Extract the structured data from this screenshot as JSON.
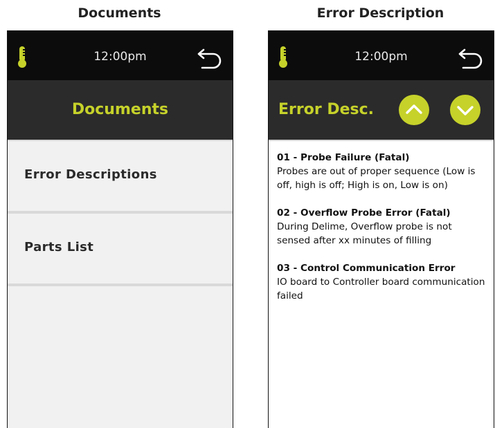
{
  "captions": {
    "left": "Documents",
    "right": "Error Description"
  },
  "status_bar": {
    "time": "12:00pm"
  },
  "documents_screen": {
    "title": "Documents",
    "items": [
      {
        "label": "Error Descriptions"
      },
      {
        "label": "Parts List"
      }
    ]
  },
  "error_screen": {
    "title": "Error Desc.",
    "errors": [
      {
        "title": "01 - Probe Failure (Fatal)",
        "desc": "Probes are out of proper sequence (Low is off, high is off; High is on, Low is on)"
      },
      {
        "title": "02 - Overflow Probe Error (Fatal)",
        "desc": "During Delime, Overflow probe is not sensed after xx minutes of filling"
      },
      {
        "title": "03 - Control Communication Error",
        "desc": "IO board to Controller board communication failed"
      }
    ]
  },
  "colors": {
    "accent": "#c6d22a",
    "topbar": "#0c0c0c",
    "titlebar": "#2b2b2b",
    "list_bg": "#f1f1f1"
  },
  "icons": {
    "status": "thermometer-icon",
    "back": "back-arrow-icon",
    "up": "chevron-up-icon",
    "down": "chevron-down-icon"
  }
}
